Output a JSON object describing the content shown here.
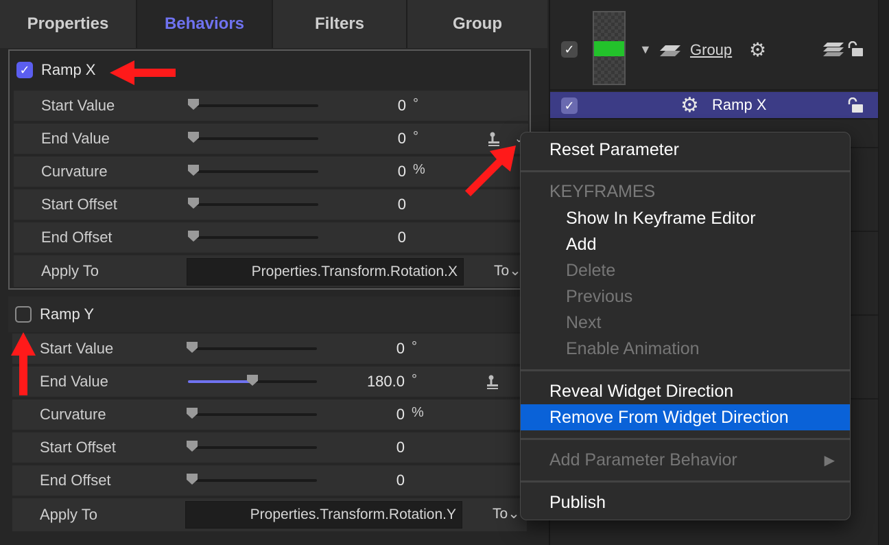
{
  "tabs": [
    "Properties",
    "Behaviors",
    "Filters",
    "Group"
  ],
  "active_tab": "Behaviors",
  "behaviors": [
    {
      "title": "Ramp X",
      "enabled": true,
      "params": [
        {
          "label": "Start Value",
          "value": "0",
          "unit": "°"
        },
        {
          "label": "End Value",
          "value": "0",
          "unit": "°"
        },
        {
          "label": "Curvature",
          "value": "0",
          "unit": "%"
        },
        {
          "label": "Start Offset",
          "value": "0",
          "unit": ""
        },
        {
          "label": "End Offset",
          "value": "0",
          "unit": ""
        }
      ],
      "apply_label": "Apply To",
      "apply_value": "Properties.Transform.Rotation.X",
      "apply_to_button": "To"
    },
    {
      "title": "Ramp Y",
      "enabled": false,
      "params": [
        {
          "label": "Start Value",
          "value": "0",
          "unit": "°"
        },
        {
          "label": "End Value",
          "value": "180.0",
          "unit": "°",
          "slider_fraction": 0.5
        },
        {
          "label": "Curvature",
          "value": "0",
          "unit": "%"
        },
        {
          "label": "Start Offset",
          "value": "0",
          "unit": ""
        },
        {
          "label": "End Offset",
          "value": "0",
          "unit": ""
        }
      ],
      "apply_label": "Apply To",
      "apply_value": "Properties.Transform.Rotation.Y",
      "apply_to_button": "To"
    }
  ],
  "layers": {
    "group_name": "Group",
    "selected_item": "Ramp X",
    "thumbnail_color": "#23c22b",
    "selection_color": "#3c3c86"
  },
  "menu": {
    "reset": "Reset Parameter",
    "keyframes_header": "KEYFRAMES",
    "keyframe_items": [
      {
        "label": "Show In Keyframe Editor",
        "enabled": true
      },
      {
        "label": "Add",
        "enabled": true
      },
      {
        "label": "Delete",
        "enabled": false
      },
      {
        "label": "Previous",
        "enabled": false
      },
      {
        "label": "Next",
        "enabled": false
      },
      {
        "label": "Enable Animation",
        "enabled": false
      }
    ],
    "reveal": "Reveal Widget Direction",
    "remove": "Remove From Widget Direction",
    "add_param_behavior": "Add Parameter Behavior",
    "publish": "Publish",
    "highlight_color": "#0a62d8"
  },
  "icons": {
    "gear": "⚙",
    "check": "✓",
    "disclosure": "▼",
    "submenu": "▶",
    "chevron": "⌄"
  },
  "annotation_color": "#ff1a1a"
}
